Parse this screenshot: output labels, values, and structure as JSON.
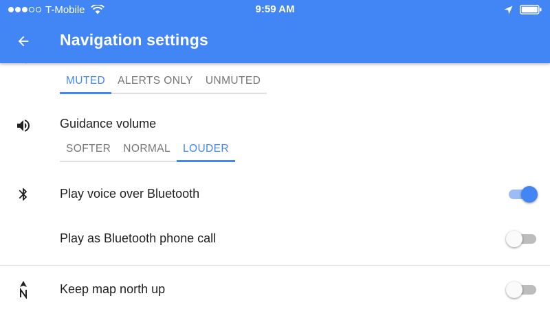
{
  "status_bar": {
    "carrier": "T-Mobile",
    "signal_bars_filled": 3,
    "signal_bars_total": 5,
    "time": "9:59 AM",
    "icons": [
      "wifi-icon",
      "location-arrow-icon",
      "battery-icon"
    ]
  },
  "app_bar": {
    "title": "Navigation settings",
    "back_icon": "arrow-back-icon"
  },
  "voice_mode": {
    "options": [
      "MUTED",
      "ALERTS ONLY",
      "UNMUTED"
    ],
    "selected": "MUTED"
  },
  "guidance_volume": {
    "label": "Guidance volume",
    "icon": "volume-icon",
    "options": [
      "SOFTER",
      "NORMAL",
      "LOUDER"
    ],
    "selected": "LOUDER"
  },
  "bluetooth_voice": {
    "label": "Play voice over Bluetooth",
    "icon": "bluetooth-icon",
    "enabled": true
  },
  "bluetooth_call": {
    "label": "Play as Bluetooth phone call",
    "enabled": false
  },
  "north_up": {
    "label": "Keep map north up",
    "icon": "compass-north-icon",
    "enabled": false
  },
  "colors": {
    "primary": "#4285f4",
    "toggle_track_on": "#9cbcf7",
    "toggle_track_off": "#bdbdbd",
    "text_primary": "#212121",
    "text_secondary": "#757575"
  }
}
